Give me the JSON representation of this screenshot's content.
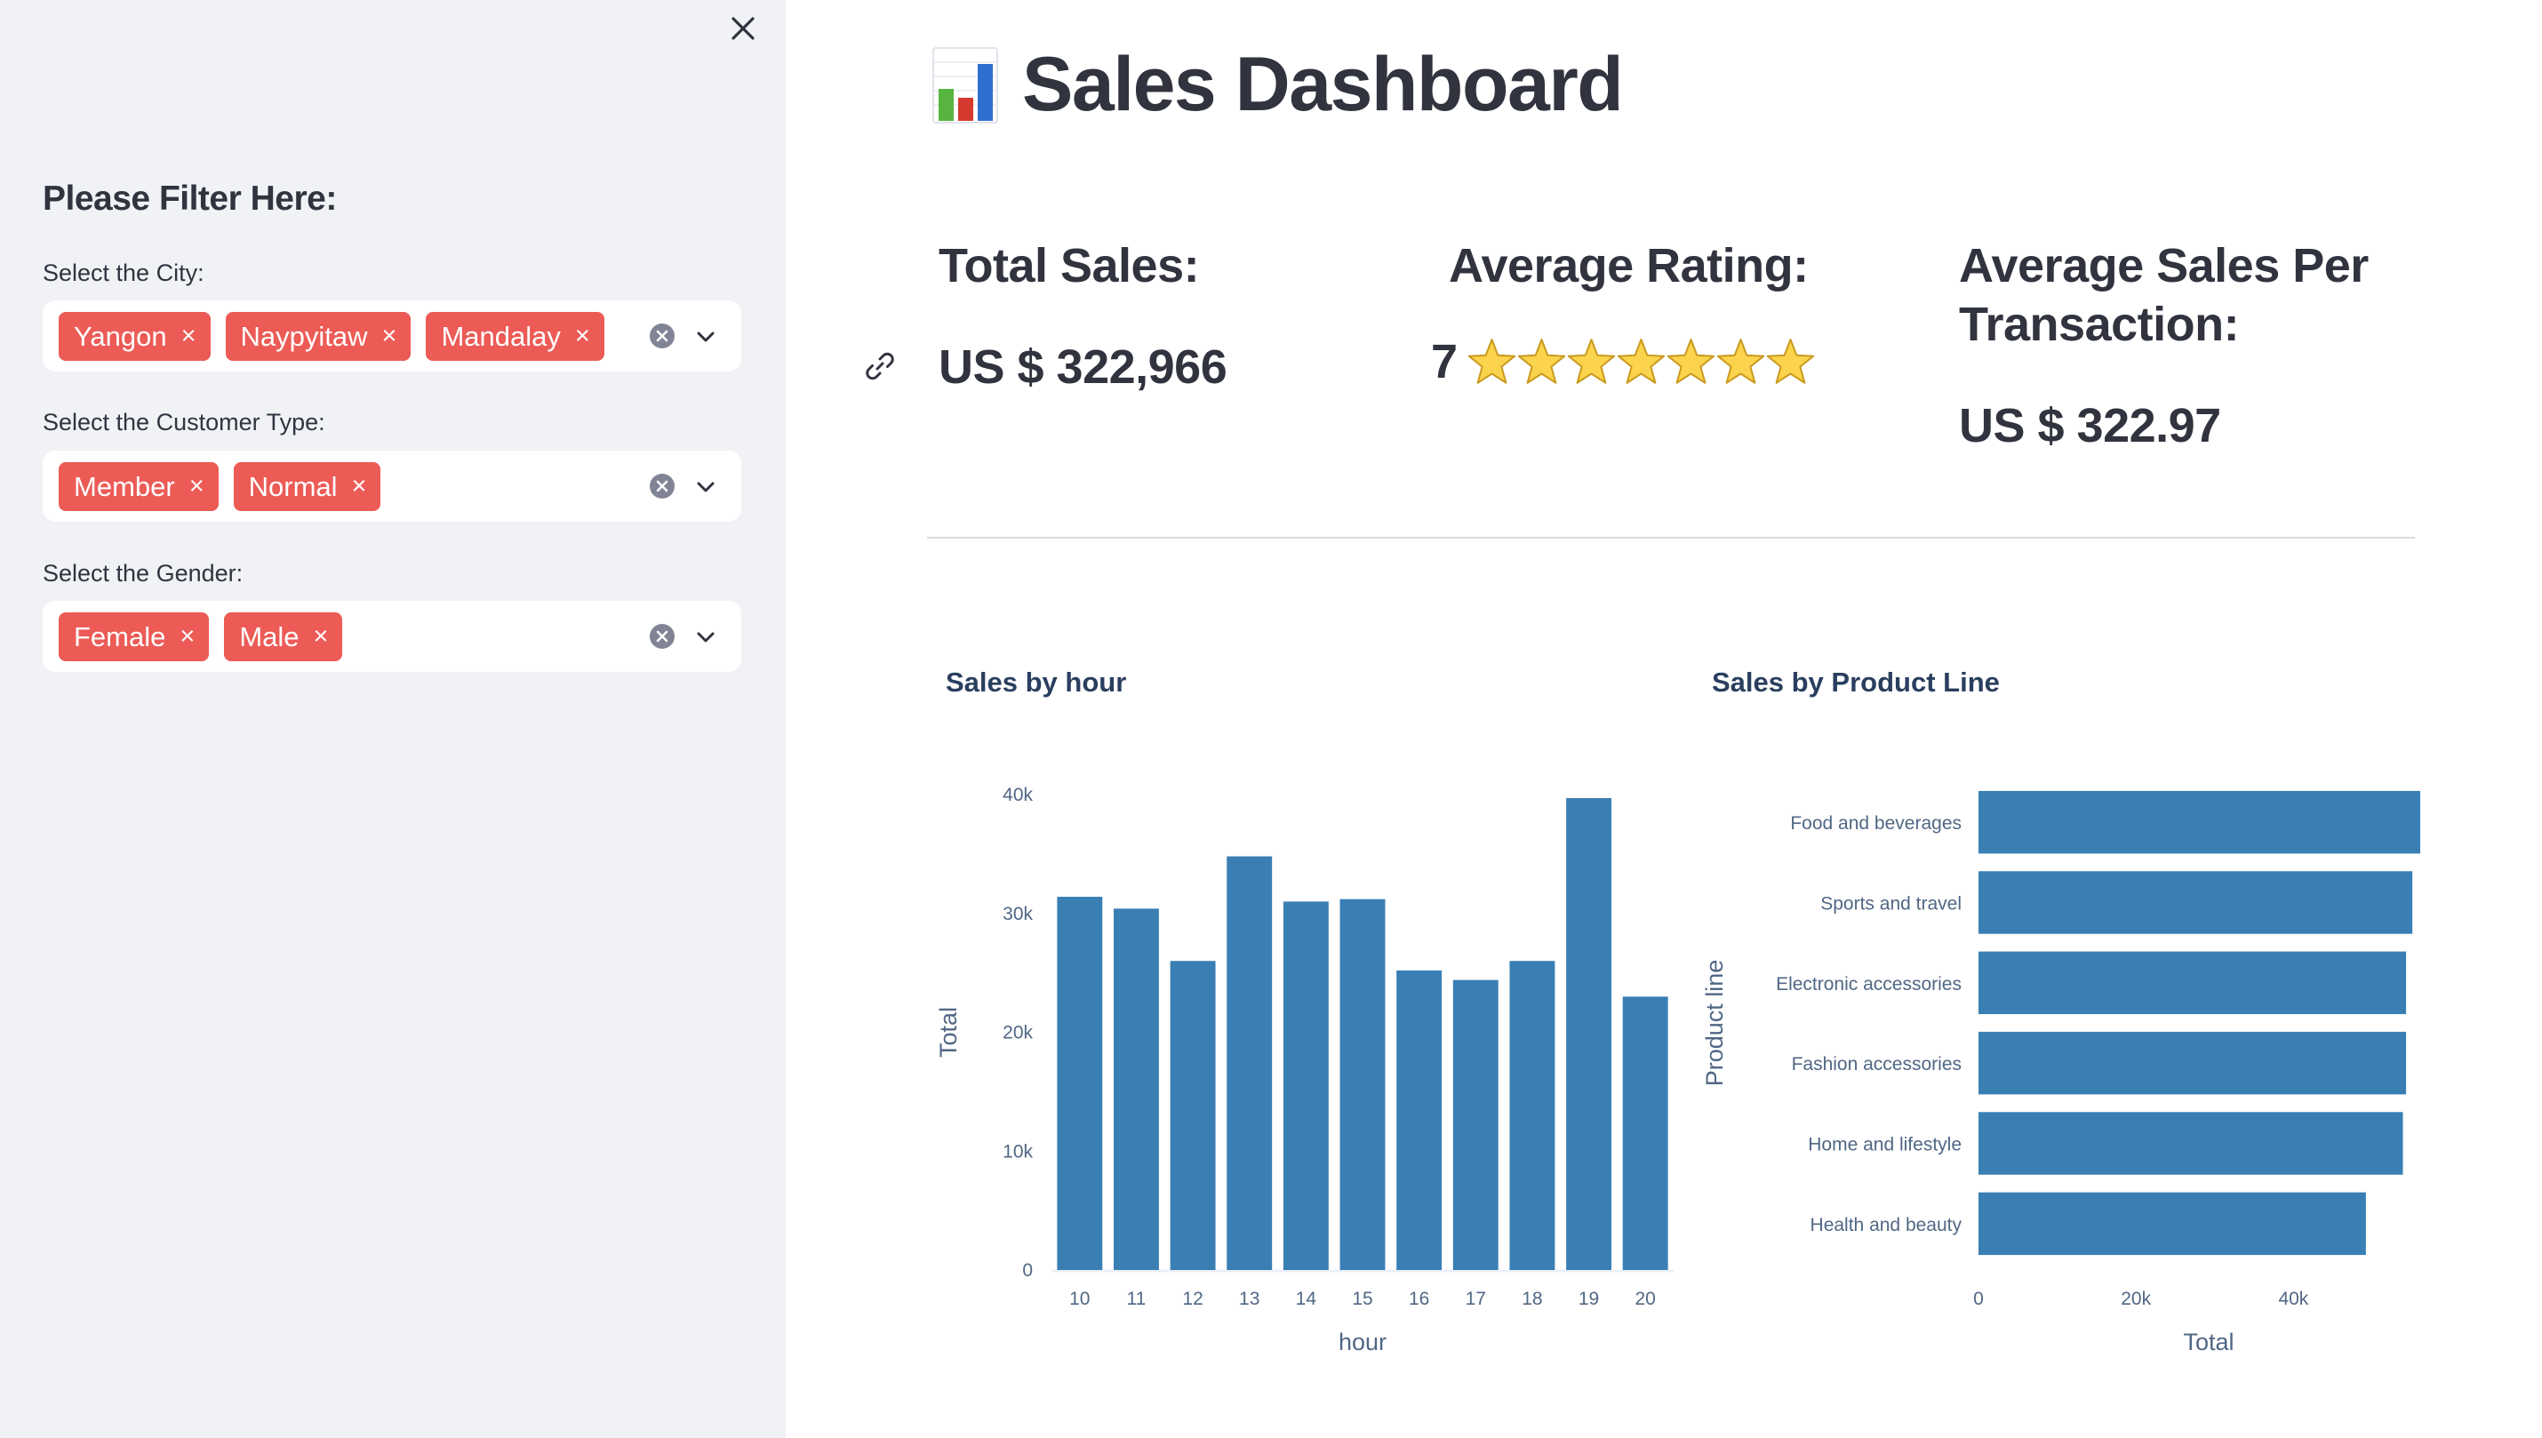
{
  "sidebar": {
    "header": "Please Filter Here:",
    "filters": [
      {
        "label": "Select the City:",
        "tags": [
          "Yangon",
          "Naypyitaw",
          "Mandalay"
        ]
      },
      {
        "label": "Select the Customer Type:",
        "tags": [
          "Member",
          "Normal"
        ]
      },
      {
        "label": "Select the Gender:",
        "tags": [
          "Female",
          "Male"
        ]
      }
    ],
    "tag_remove_glyph": "×"
  },
  "main": {
    "title": "Sales Dashboard",
    "title_icon": "bar-chart-icon",
    "kpis": {
      "total_sales": {
        "label": "Total Sales:",
        "value": "US $ 322,966"
      },
      "average_rating": {
        "label": "Average Rating:",
        "value": "7",
        "stars": 7
      },
      "avg_per_transaction": {
        "label": "Average Sales Per Transaction:",
        "value": "US $ 322.97"
      }
    }
  },
  "colors": {
    "accent": "#ec5b56",
    "bar": "#3a7fb4",
    "sidebar_bg": "#f0f2f6",
    "text": "#31333f"
  },
  "chart_data": [
    {
      "type": "bar",
      "title": "Sales by hour",
      "xlabel": "hour",
      "ylabel": "Total",
      "categories": [
        "10",
        "11",
        "12",
        "13",
        "14",
        "15",
        "16",
        "17",
        "18",
        "19",
        "20"
      ],
      "values": [
        31400,
        30400,
        26000,
        34800,
        31000,
        31200,
        25200,
        24400,
        26000,
        39700,
        23000
      ],
      "ylim": [
        0,
        40000
      ],
      "yticks": [
        "0",
        "10k",
        "20k",
        "30k",
        "40k"
      ],
      "grid": false
    },
    {
      "type": "bar",
      "orientation": "horizontal",
      "title": "Sales by Product Line",
      "xlabel": "Total",
      "ylabel": "Product line",
      "categories": [
        "Food and beverages",
        "Sports and travel",
        "Electronic accessories",
        "Fashion accessories",
        "Home and lifestyle",
        "Health and beauty"
      ],
      "values": [
        56100,
        55100,
        54300,
        54300,
        53900,
        49200
      ],
      "xlim": [
        0,
        56100
      ],
      "xticks": [
        "0",
        "20k",
        "40k"
      ],
      "grid": false
    }
  ]
}
